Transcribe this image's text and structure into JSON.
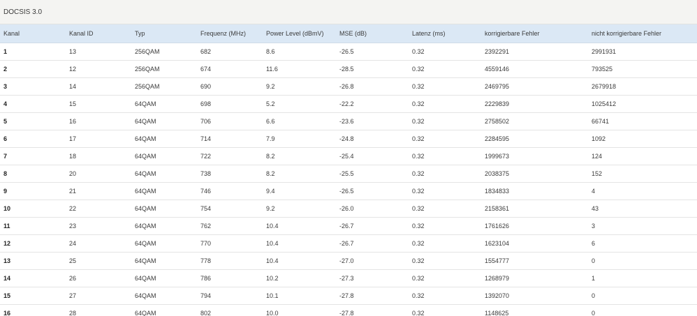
{
  "section": {
    "title": "DOCSIS 3.0"
  },
  "table": {
    "headers": [
      "Kanal",
      "Kanal ID",
      "Typ",
      "Frequenz (MHz)",
      "Power Level (dBmV)",
      "MSE (dB)",
      "Latenz (ms)",
      "korrigierbare Fehler",
      "nicht korrigierbare Fehler"
    ],
    "rows": [
      [
        "1",
        "13",
        "256QAM",
        "682",
        "8.6",
        "-26.5",
        "0.32",
        "2392291",
        "2991931"
      ],
      [
        "2",
        "12",
        "256QAM",
        "674",
        "11.6",
        "-28.5",
        "0.32",
        "4559146",
        "793525"
      ],
      [
        "3",
        "14",
        "256QAM",
        "690",
        "9.2",
        "-26.8",
        "0.32",
        "2469795",
        "2679918"
      ],
      [
        "4",
        "15",
        "64QAM",
        "698",
        "5.2",
        "-22.2",
        "0.32",
        "2229839",
        "1025412"
      ],
      [
        "5",
        "16",
        "64QAM",
        "706",
        "6.6",
        "-23.6",
        "0.32",
        "2758502",
        "66741"
      ],
      [
        "6",
        "17",
        "64QAM",
        "714",
        "7.9",
        "-24.8",
        "0.32",
        "2284595",
        "1092"
      ],
      [
        "7",
        "18",
        "64QAM",
        "722",
        "8.2",
        "-25.4",
        "0.32",
        "1999673",
        "124"
      ],
      [
        "8",
        "20",
        "64QAM",
        "738",
        "8.2",
        "-25.5",
        "0.32",
        "2038375",
        "152"
      ],
      [
        "9",
        "21",
        "64QAM",
        "746",
        "9.4",
        "-26.5",
        "0.32",
        "1834833",
        "4"
      ],
      [
        "10",
        "22",
        "64QAM",
        "754",
        "9.2",
        "-26.0",
        "0.32",
        "2158361",
        "43"
      ],
      [
        "11",
        "23",
        "64QAM",
        "762",
        "10.4",
        "-26.7",
        "0.32",
        "1761626",
        "3"
      ],
      [
        "12",
        "24",
        "64QAM",
        "770",
        "10.4",
        "-26.7",
        "0.32",
        "1623104",
        "6"
      ],
      [
        "13",
        "25",
        "64QAM",
        "778",
        "10.4",
        "-27.0",
        "0.32",
        "1554777",
        "0"
      ],
      [
        "14",
        "26",
        "64QAM",
        "786",
        "10.2",
        "-27.3",
        "0.32",
        "1268979",
        "1"
      ],
      [
        "15",
        "27",
        "64QAM",
        "794",
        "10.1",
        "-27.8",
        "0.32",
        "1392070",
        "0"
      ],
      [
        "16",
        "28",
        "64QAM",
        "802",
        "10.0",
        "-27.8",
        "0.32",
        "1148625",
        "0"
      ]
    ]
  }
}
